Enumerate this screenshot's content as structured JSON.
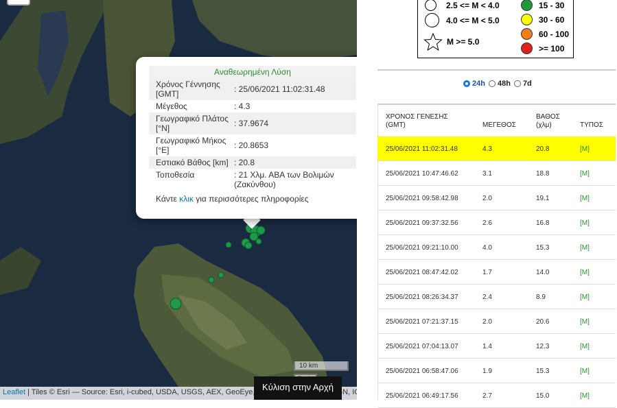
{
  "map": {
    "zoom_control": "",
    "popup": {
      "title": "Αναθεωρημένη Λύση",
      "rows": [
        {
          "label": "Χρόνος Γέννησης [GMT]",
          "value": ": 25/06/2021 11:02:31.48"
        },
        {
          "label": "Μέγεθος",
          "value": ": 4.3"
        },
        {
          "label": "Γεωγραφικό Πλάτος [°N]",
          "value": ": 37.9674"
        },
        {
          "label": "Γεωγραφικό Μήκος [°E]",
          "value": ": 20.8653"
        },
        {
          "label": "Εστιακό Βάθος [km]",
          "value": ": 20.8"
        },
        {
          "label": "Τοποθεσία",
          "value": ": 21 Χλμ. ΑΒΑ των Βολιμών (Ζακύνθου)"
        }
      ],
      "more_prefix": "Κάντε ",
      "more_link": "κλικ",
      "more_suffix": " για περισσότερες πληροφορίες"
    },
    "scale_km": "10 km",
    "scale_mi": "5 mi",
    "attribution_link": "Leaflet",
    "attribution_text": " | Tiles © Esri — Source: Esri, i-cubed, USDA, USGS, AEX, GeoEye, Getmapping, Aerogrid, IGN, IGP, UPR-EGP, and the GIS User Community, N,",
    "scroll_top_label": "Κύλιση στην Αρχή",
    "marker_color": "#1e9a4a"
  },
  "legend": {
    "mag_items": [
      "2.5 <= M < 4.0",
      "4.0 <= M < 5.0",
      "M >= 5.0"
    ],
    "depth_items": [
      {
        "label": "15 - 30",
        "color": "#1e9a3a"
      },
      {
        "label": "30 - 60",
        "color": "#ffff00"
      },
      {
        "label": "60 - 100",
        "color": "#f07f1a"
      },
      {
        "label": ">= 100",
        "color": "#e02020"
      }
    ]
  },
  "filters": {
    "options": [
      "24h",
      "48h",
      "7d"
    ],
    "selected": "24h"
  },
  "table": {
    "headers": {
      "time": "ΧΡΟΝΟΣ ΓΕΝΕΣΗΣ (GMT)",
      "magnitude": "ΜΕΓΕΘΟΣ",
      "depth": "ΒΑΘΟΣ (χλμ)",
      "type": "ΤΥΠΟΣ"
    },
    "highlight_color": "#ffff00",
    "rows": [
      {
        "time": "25/06/2021 11:02:31.48",
        "mag": "4.3",
        "depth": "20.8",
        "type": "[M]"
      },
      {
        "time": "25/06/2021 10:47:46.62",
        "mag": "3.1",
        "depth": "18.8",
        "type": "[M]"
      },
      {
        "time": "25/06/2021 09:58:42.98",
        "mag": "2.0",
        "depth": "19.1",
        "type": "[M]"
      },
      {
        "time": "25/06/2021 09:37:32.56",
        "mag": "2.6",
        "depth": "16.8",
        "type": "[M]"
      },
      {
        "time": "25/06/2021 09:21:10.00",
        "mag": "4.0",
        "depth": "15.3",
        "type": "[M]"
      },
      {
        "time": "25/06/2021 08:47:42.02",
        "mag": "1.7",
        "depth": "14.0",
        "type": "[M]"
      },
      {
        "time": "25/06/2021 08:26:34.37",
        "mag": "2.4",
        "depth": "8.9",
        "type": "[M]"
      },
      {
        "time": "25/06/2021 07:21:37.15",
        "mag": "2.0",
        "depth": "20.6",
        "type": "[M]"
      },
      {
        "time": "25/06/2021 07:04:13.07",
        "mag": "1.4",
        "depth": "12.3",
        "type": "[M]"
      },
      {
        "time": "25/06/2021 06:58:47.06",
        "mag": "1.9",
        "depth": "15.3",
        "type": "[M]"
      },
      {
        "time": "25/06/2021 06:49:17.56",
        "mag": "2.7",
        "depth": "15.0",
        "type": "[M]"
      }
    ]
  }
}
